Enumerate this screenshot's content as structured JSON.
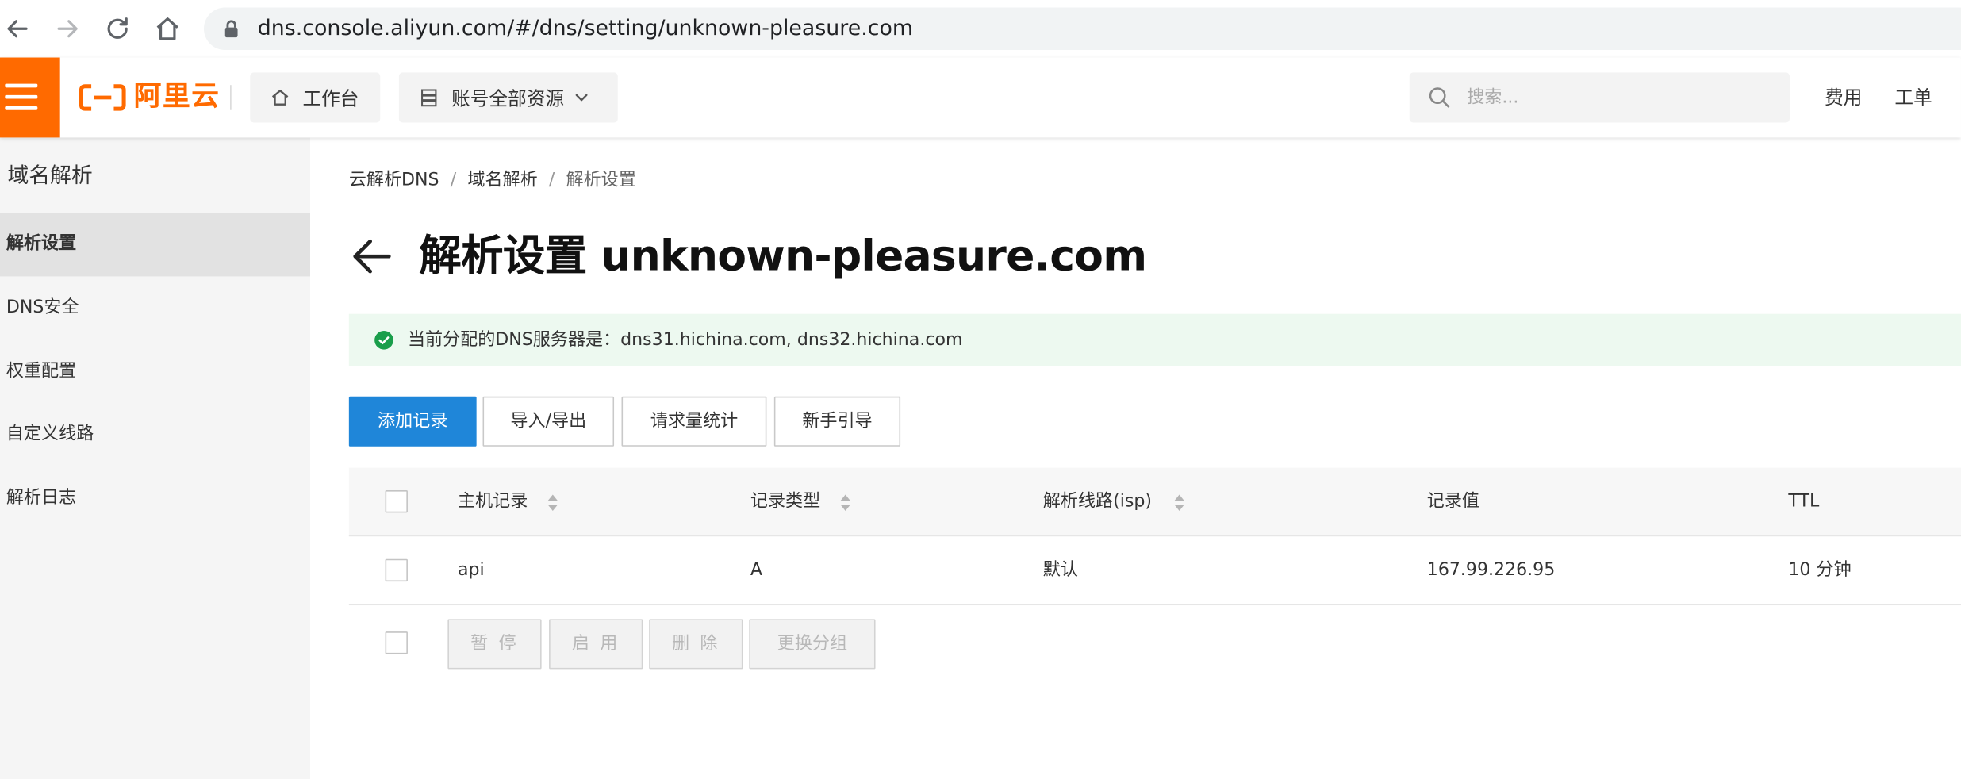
{
  "browser": {
    "url": "dns.console.aliyun.com/#/dns/setting/unknown-pleasure.com"
  },
  "topbar": {
    "logo_text": "阿里云",
    "workbench_label": "工作台",
    "resources_label": "账号全部资源",
    "search_placeholder": "搜索...",
    "links": [
      "费用",
      "工单"
    ]
  },
  "sidebar": {
    "title": "域名解析",
    "items": [
      {
        "label": "解析设置",
        "active": true
      },
      {
        "label": "DNS安全",
        "active": false
      },
      {
        "label": "权重配置",
        "active": false
      },
      {
        "label": "自定义线路",
        "active": false
      },
      {
        "label": "解析日志",
        "active": false
      }
    ]
  },
  "breadcrumb": {
    "items": [
      "云解析DNS",
      "域名解析",
      "解析设置"
    ],
    "separator": "/"
  },
  "page": {
    "title": "解析设置 unknown-pleasure.com"
  },
  "notice": {
    "text": "当前分配的DNS服务器是：dns31.hichina.com, dns32.hichina.com"
  },
  "toolbar": {
    "add_record": "添加记录",
    "import_export": "导入/导出",
    "request_stats": "请求量统计",
    "guide": "新手引导"
  },
  "table": {
    "headers": [
      "主机记录",
      "记录类型",
      "解析线路(isp)",
      "记录值",
      "TTL"
    ],
    "rows": [
      {
        "host": "api",
        "type": "A",
        "line": "默认",
        "value": "167.99.226.95",
        "ttl": "10 分钟"
      }
    ]
  },
  "bulk_actions": {
    "pause": "暂 停",
    "enable": "启 用",
    "delete": "删 除",
    "change_group": "更换分组"
  },
  "colors": {
    "brand": "#ff6a00",
    "primary": "#1f86d9",
    "success": "#1a9e4b",
    "notice_bg": "#edf9f0"
  }
}
